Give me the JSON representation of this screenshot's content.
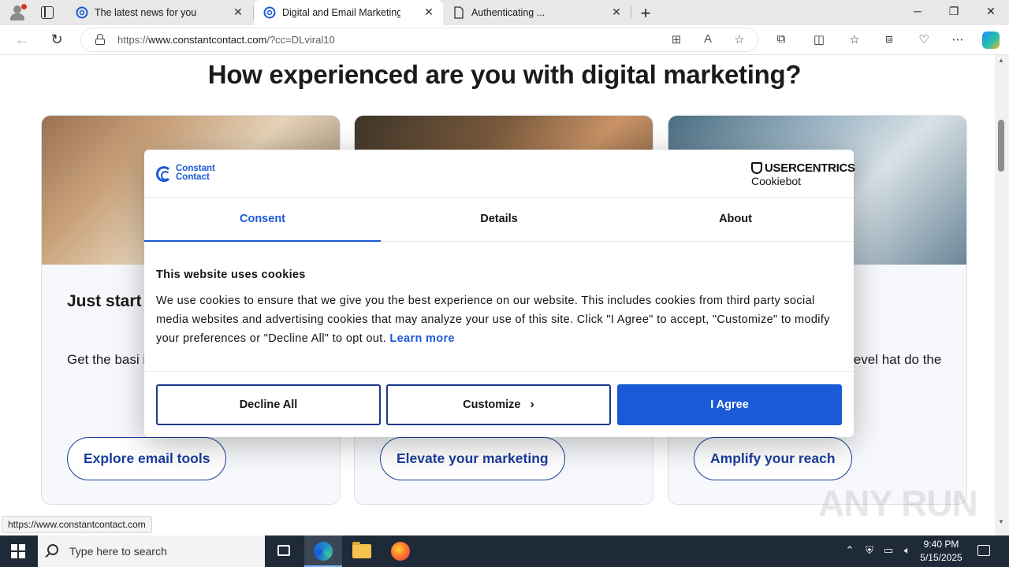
{
  "browser": {
    "tabs": [
      {
        "title": "The latest news for you",
        "active": false
      },
      {
        "title": "Digital and Email Marketing Platf",
        "active": true
      },
      {
        "title": "Authenticating ...",
        "active": false
      }
    ],
    "url_prefix": "https://",
    "url_host": "www.constantcontact.com",
    "url_path": "/?cc=DLviral10",
    "status_url": "https://www.constantcontact.com"
  },
  "page": {
    "headline": "How experienced are you with digital marketing?",
    "cards": [
      {
        "title": "Just start",
        "text": "Get the basi into email co clicks.",
        "button": "Explore email tools"
      },
      {
        "title": "",
        "text": "",
        "button": "Elevate your marketing"
      },
      {
        "title": "",
        "text": "e next level hat do the",
        "button": "Amplify your reach"
      }
    ]
  },
  "cookie_dialog": {
    "brand_line1": "Constant",
    "brand_line2": "Contact",
    "provider_name": "USERCENTRICS",
    "provider_product": "Cookiebot",
    "tabs": [
      {
        "label": "Consent",
        "active": true
      },
      {
        "label": "Details",
        "active": false
      },
      {
        "label": "About",
        "active": false
      }
    ],
    "heading": "This website uses cookies",
    "body": "We use cookies to ensure that we give you the best experience on our website. This includes cookies from third party social media websites and advertising cookies that may analyze your use of this site. Click \"I Agree\" to accept, \"Customize\" to modify your preferences or \"Decline All\" to opt out.",
    "learn_more": "Learn more",
    "buttons": {
      "decline": "Decline All",
      "customize": "Customize",
      "agree": "I Agree"
    }
  },
  "watermark": "ANY RUN",
  "taskbar": {
    "search_placeholder": "Type here to search",
    "time": "9:40 PM",
    "date": "5/15/2025"
  },
  "colors": {
    "accent": "#1a5ad7",
    "button_border": "#1b3a8c",
    "taskbar": "#1f2a38"
  }
}
